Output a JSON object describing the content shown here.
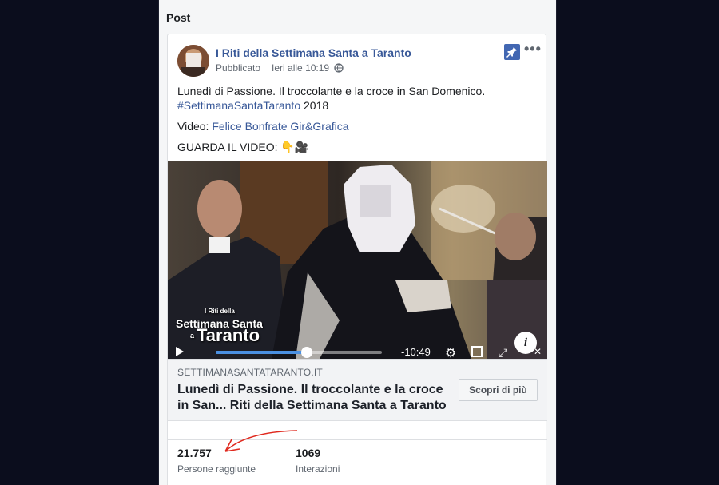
{
  "panel": {
    "title": "Post"
  },
  "post": {
    "author": "I Riti della Settimana Santa a Taranto",
    "published_prefix": "Pubblicato",
    "published_time": "Ieri alle 10:19",
    "line1": "Lunedì di Passione. Il troccolante e la croce in San Domenico.",
    "hashtag": "#SettimanaSantaTaranto",
    "hashtag_suffix": " 2018",
    "video_credit_label": "Video: ",
    "video_credit": "Felice Bonfrate Gir&Grafica",
    "cta_text": "GUARDA IL VIDEO: 👇🎥"
  },
  "video": {
    "watermark": {
      "l1": "I Riti della",
      "l2": "Settimana Santa",
      "l3": "a",
      "l4": "Taranto"
    },
    "time_remaining": "-10:49",
    "progress": 0.55
  },
  "link": {
    "domain": "SETTIMANASANTATARANTO.IT",
    "title": "Lunedì di Passione. Il troccolante e la croce in San... Riti della Settimana Santa a Taranto",
    "button": "Scopri di più"
  },
  "stats": {
    "reach_value": "21.757",
    "reach_label": "Persone raggiunte",
    "interactions_value": "1069",
    "interactions_label": "Interazioni"
  },
  "icons": {
    "pin": "pin-icon",
    "more": "more-options-icon",
    "globe": "globe-icon",
    "play": "play-icon",
    "settings": "gear-icon",
    "pip": "picture-in-picture-icon",
    "fullscreen": "fullscreen-icon",
    "info": "info-icon",
    "volume": "volume-icon"
  },
  "colors": {
    "link": "#385898",
    "pin": "#4267b2",
    "annotation": "#e0291e",
    "background": "#0b0d1d"
  }
}
